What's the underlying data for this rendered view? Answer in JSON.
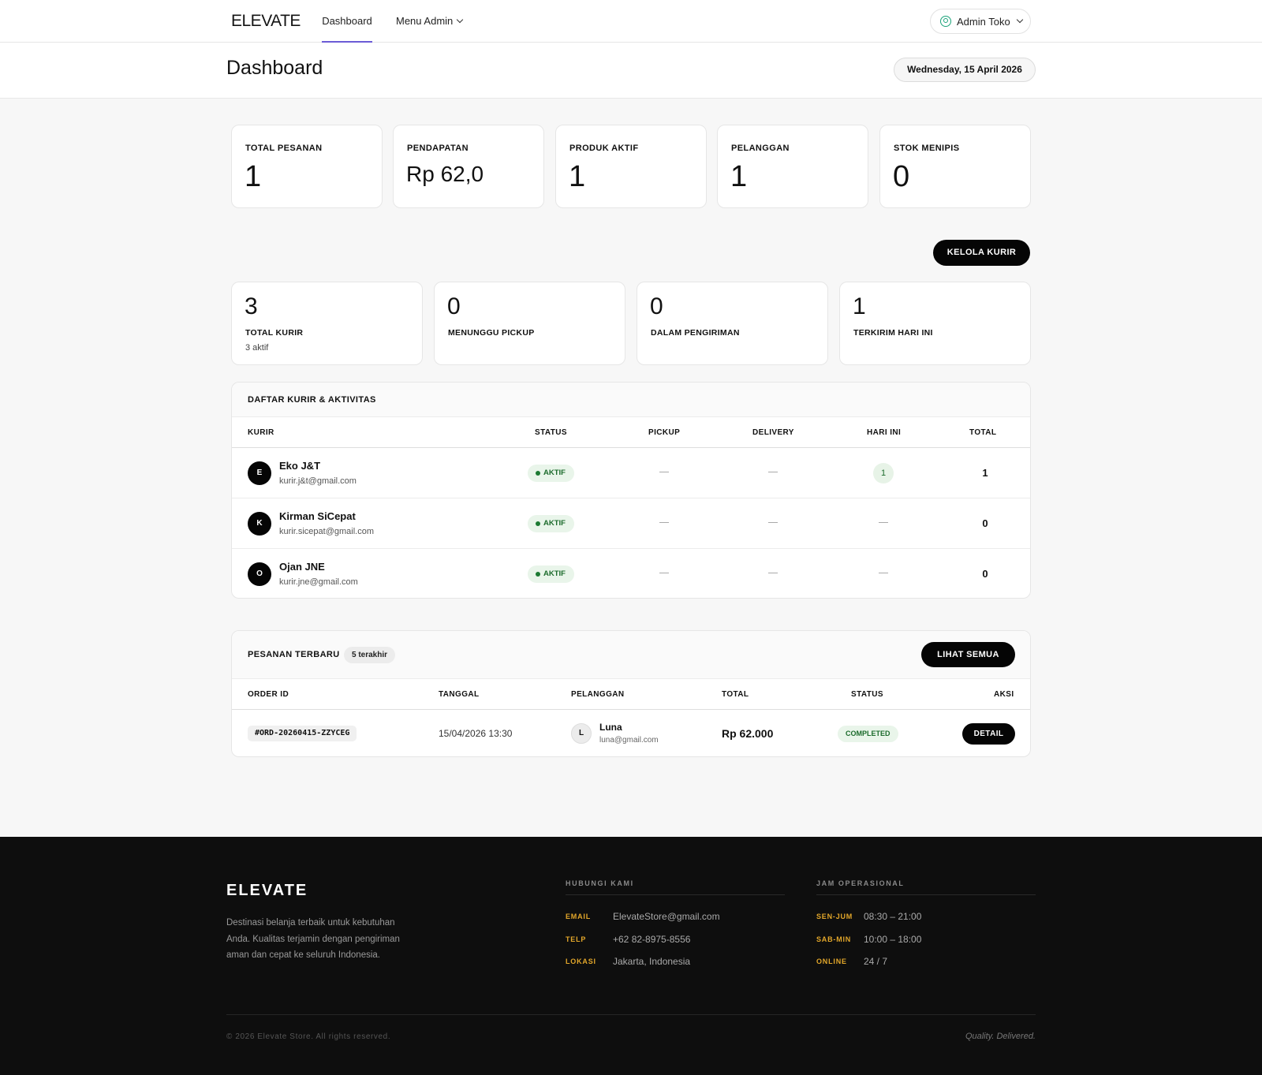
{
  "nav": {
    "brand": "ELEVATE",
    "dashboard": "Dashboard",
    "menu_admin": "Menu Admin",
    "user": "Admin Toko"
  },
  "header": {
    "title": "Dashboard",
    "date": "Wednesday, 15 April 2026"
  },
  "stats": [
    {
      "label": "TOTAL PESANAN",
      "value": "1"
    },
    {
      "label": "PENDAPATAN",
      "value": "Rp 62,0"
    },
    {
      "label": "PRODUK AKTIF",
      "value": "1"
    },
    {
      "label": "PELANGGAN",
      "value": "1"
    },
    {
      "label": "STOK MENIPIS",
      "value": "0"
    }
  ],
  "kelola_kurir": "KELOLA KURIR",
  "courier_stats": [
    {
      "value": "3",
      "label": "TOTAL KURIR",
      "sub": "3 aktif"
    },
    {
      "value": "0",
      "label": "MENUNGGU PICKUP",
      "sub": ""
    },
    {
      "value": "0",
      "label": "DALAM PENGIRIMAN",
      "sub": ""
    },
    {
      "value": "1",
      "label": "TERKIRIM HARI INI",
      "sub": ""
    }
  ],
  "couriers": {
    "title": "DAFTAR KURIR & AKTIVITAS",
    "columns": [
      "KURIR",
      "STATUS",
      "PICKUP",
      "DELIVERY",
      "HARI INI",
      "TOTAL"
    ],
    "rows": [
      {
        "initial": "E",
        "name": "Eko J&T",
        "email": "kurir.j&t@gmail.com",
        "status": "AKTIF",
        "today": "1",
        "total": "1"
      },
      {
        "initial": "K",
        "name": "Kirman SiCepat",
        "email": "kurir.sicepat@gmail.com",
        "status": "AKTIF",
        "today": "",
        "total": "0"
      },
      {
        "initial": "O",
        "name": "Ojan JNE",
        "email": "kurir.jne@gmail.com",
        "status": "AKTIF",
        "today": "",
        "total": "0"
      }
    ]
  },
  "orders": {
    "title": "PESANAN TERBARU",
    "badge": "5 terakhir",
    "view_all": "LIHAT SEMUA",
    "columns": [
      "ORDER ID",
      "TANGGAL",
      "PELANGGAN",
      "TOTAL",
      "STATUS",
      "AKSI"
    ],
    "rows": [
      {
        "id": "#ORD-20260415-ZZYCEG",
        "date": "15/04/2026 13:30",
        "initial": "L",
        "name": "Luna",
        "email": "luna@gmail.com",
        "total": "Rp 62.000",
        "status": "COMPLETED",
        "action": "DETAIL"
      }
    ]
  },
  "footer": {
    "brand": "ELEVATE",
    "desc": "Destinasi belanja terbaik untuk kebutuhan Anda. Kualitas terjamin dengan pengiriman aman dan cepat ke seluruh Indonesia.",
    "contact_title": "HUBUNGI KAMI",
    "contact": [
      {
        "key": "EMAIL",
        "value": "ElevateStore@gmail.com"
      },
      {
        "key": "TELP",
        "value": "+62 82-8975-8556"
      },
      {
        "key": "LOKASI",
        "value": "Jakarta, Indonesia"
      }
    ],
    "hours_title": "JAM OPERASIONAL",
    "hours": [
      {
        "key": "SEN-JUM",
        "value": "08:30 – 21:00"
      },
      {
        "key": "SAB-MIN",
        "value": "10:00 – 18:00"
      },
      {
        "key": "ONLINE",
        "value": "24 / 7"
      }
    ],
    "copyright": "© 2026 Elevate Store. All rights reserved.",
    "tagline": "Quality. Delivered."
  }
}
